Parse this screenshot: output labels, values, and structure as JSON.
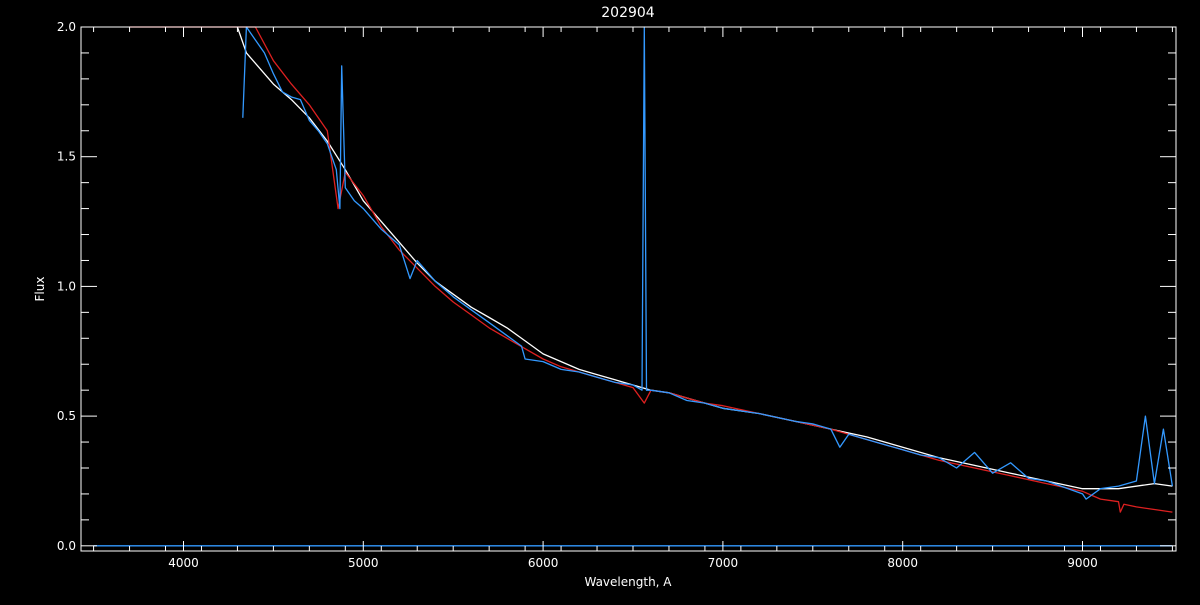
{
  "chart_data": {
    "type": "line",
    "title": "202904",
    "xlabel": "Wavelength, A",
    "ylabel": "Flux",
    "xlim": [
      3430,
      9520
    ],
    "ylim": [
      -0.02,
      2.0
    ],
    "x_ticks": [
      4000,
      5000,
      6000,
      7000,
      8000,
      9000
    ],
    "x_tick_labels": [
      "4000",
      "5000",
      "6000",
      "7000",
      "8000",
      "9000"
    ],
    "y_ticks": [
      0.0,
      0.5,
      1.0,
      1.5,
      2.0
    ],
    "y_tick_labels": [
      "0.0",
      "0.5",
      "1.0",
      "1.5",
      "2.0"
    ],
    "background": "#000000",
    "axis_color": "#ffffff",
    "series": [
      {
        "color": "#ffffff",
        "x": [
          4300,
          4350,
          4400,
          4500,
          4600,
          4700,
          4800,
          4900,
          5000,
          5100,
          5200,
          5300,
          5400,
          5500,
          5600,
          5700,
          5800,
          5900,
          6000,
          6100,
          6200,
          6300,
          6400,
          6500,
          6600,
          6700,
          6800,
          6900,
          7000,
          7200,
          7400,
          7600,
          7800,
          8000,
          8200,
          8400,
          8600,
          8800,
          9000,
          9200,
          9400,
          9500
        ],
        "y": [
          2.0,
          1.9,
          1.86,
          1.78,
          1.72,
          1.65,
          1.56,
          1.45,
          1.33,
          1.25,
          1.17,
          1.09,
          1.02,
          0.97,
          0.92,
          0.88,
          0.84,
          0.79,
          0.74,
          0.71,
          0.68,
          0.66,
          0.64,
          0.62,
          0.6,
          0.59,
          0.57,
          0.55,
          0.53,
          0.51,
          0.48,
          0.45,
          0.42,
          0.38,
          0.34,
          0.31,
          0.28,
          0.25,
          0.22,
          0.22,
          0.24,
          0.23
        ]
      },
      {
        "color": "#dd2020",
        "x": [
          3700,
          4300,
          4400,
          4500,
          4600,
          4700,
          4800,
          4860,
          4900,
          5000,
          5100,
          5200,
          5300,
          5400,
          5500,
          5600,
          5700,
          5800,
          5900,
          6000,
          6100,
          6200,
          6300,
          6400,
          6500,
          6563,
          6600,
          6700,
          6800,
          6900,
          7000,
          7200,
          7400,
          7600,
          7800,
          8000,
          8200,
          8400,
          8600,
          8800,
          9000,
          9100,
          9200,
          9210,
          9230,
          9300,
          9400,
          9500
        ],
        "y": [
          2.0,
          2.0,
          2.0,
          1.87,
          1.78,
          1.7,
          1.6,
          1.3,
          1.44,
          1.35,
          1.23,
          1.14,
          1.07,
          1.0,
          0.94,
          0.89,
          0.84,
          0.8,
          0.76,
          0.72,
          0.69,
          0.67,
          0.65,
          0.63,
          0.61,
          0.55,
          0.6,
          0.59,
          0.57,
          0.55,
          0.54,
          0.51,
          0.48,
          0.45,
          0.41,
          0.37,
          0.33,
          0.3,
          0.27,
          0.24,
          0.21,
          0.18,
          0.17,
          0.13,
          0.16,
          0.15,
          0.14,
          0.13
        ]
      },
      {
        "color": "#3399ff",
        "x": [
          4330,
          4350,
          4400,
          4450,
          4500,
          4550,
          4600,
          4650,
          4700,
          4750,
          4800,
          4850,
          4870,
          4880,
          4900,
          4950,
          5000,
          5100,
          5200,
          5260,
          5300,
          5400,
          5500,
          5600,
          5700,
          5800,
          5880,
          5900,
          6000,
          6100,
          6200,
          6300,
          6400,
          6500,
          6550,
          6563,
          6575,
          6600,
          6700,
          6800,
          6900,
          7000,
          7200,
          7400,
          7500,
          7600,
          7650,
          7700,
          7800,
          8000,
          8100,
          8200,
          8300,
          8400,
          8500,
          8600,
          8700,
          8800,
          9000,
          9020,
          9100,
          9200,
          9300,
          9350,
          9400,
          9450,
          9500
        ],
        "y": [
          1.65,
          2.0,
          1.95,
          1.9,
          1.82,
          1.75,
          1.73,
          1.72,
          1.64,
          1.6,
          1.55,
          1.45,
          1.3,
          1.85,
          1.38,
          1.33,
          1.3,
          1.22,
          1.16,
          1.03,
          1.1,
          1.02,
          0.96,
          0.91,
          0.86,
          0.81,
          0.77,
          0.72,
          0.71,
          0.68,
          0.67,
          0.65,
          0.63,
          0.62,
          0.6,
          2.0,
          0.6,
          0.6,
          0.59,
          0.56,
          0.55,
          0.53,
          0.51,
          0.48,
          0.47,
          0.45,
          0.38,
          0.43,
          0.41,
          0.37,
          0.35,
          0.34,
          0.3,
          0.36,
          0.28,
          0.32,
          0.26,
          0.25,
          0.2,
          0.18,
          0.22,
          0.23,
          0.25,
          0.5,
          0.24,
          0.45,
          0.23
        ]
      },
      {
        "color": "#3399ff",
        "x": [
          3500,
          4000,
          5000,
          6000,
          7000,
          8000,
          9000,
          9500
        ],
        "y": [
          0.0,
          0.0,
          0.0,
          0.0,
          0.0,
          0.0,
          0.0,
          0.0
        ]
      }
    ]
  }
}
